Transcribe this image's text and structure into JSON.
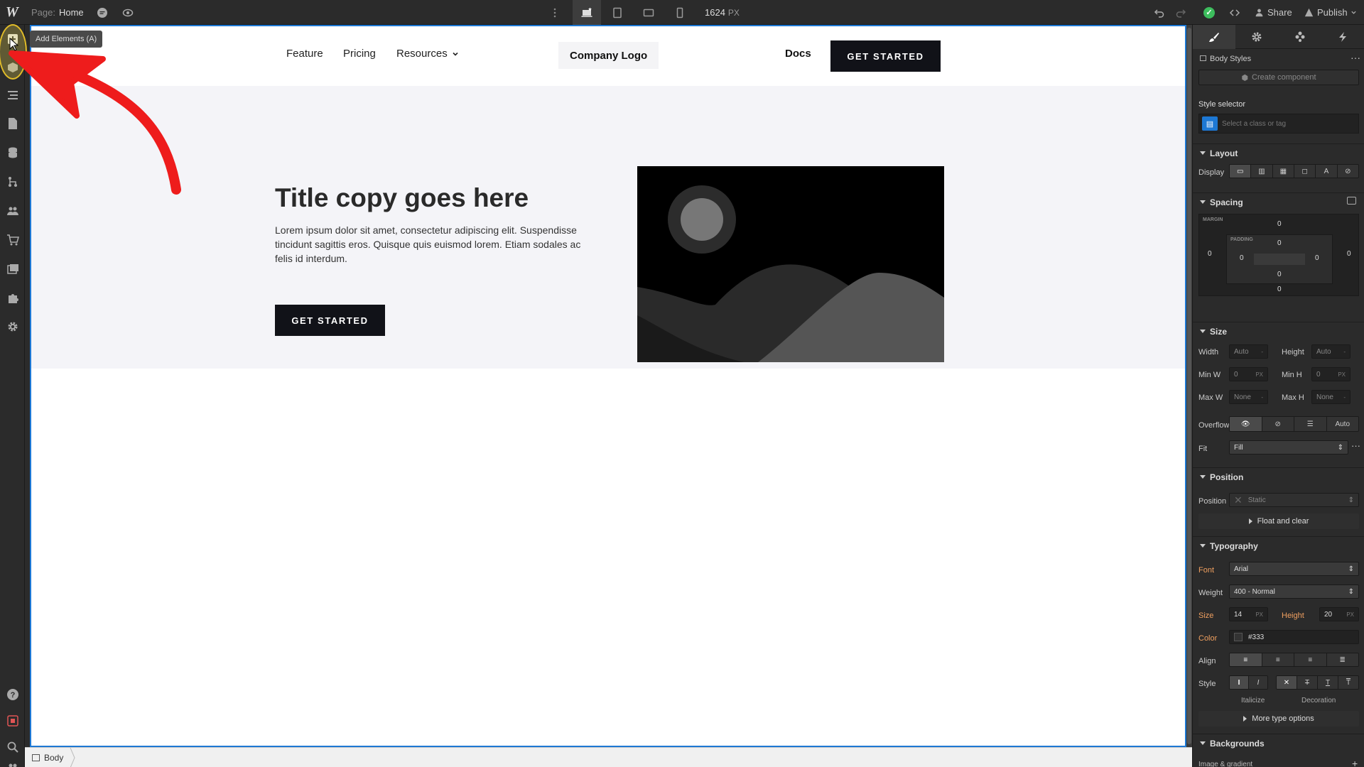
{
  "topbar": {
    "logo": "W",
    "page_prefix": "Page:",
    "page_name": "Home",
    "canvas_width": "1624",
    "canvas_unit": "PX",
    "share_label": "Share",
    "publish_label": "Publish"
  },
  "leftbar": {
    "tooltip": "Add Elements (A)",
    "icons": [
      "add-elements-icon",
      "components-icon",
      "navigator-icon",
      "pages-icon",
      "cms-icon",
      "logic-icon",
      "users-icon",
      "ecommerce-icon",
      "assets-icon",
      "apps-icon",
      "settings-icon",
      "help-icon",
      "video-icon",
      "search-icon",
      "collaborators-icon"
    ]
  },
  "site": {
    "nav": {
      "links": [
        "Feature",
        "Pricing",
        "Resources"
      ],
      "logo": "Company Logo",
      "docs": "Docs",
      "cta": "GET STARTED"
    },
    "hero": {
      "title": "Title copy goes here",
      "body": "Lorem ipsum dolor sit amet, consectetur adipiscing elit. Suspendisse tincidunt sagittis eros. Quisque quis euismod lorem. Etiam sodales ac felis id interdum.",
      "cta": "GET STARTED"
    }
  },
  "breadcrumb": {
    "item": "Body"
  },
  "panel": {
    "selection": "Body Styles",
    "create_component": "Create component",
    "style_selector_label": "Style selector",
    "style_selector_placeholder": "Select a class or tag",
    "layout": {
      "heading": "Layout",
      "display_label": "Display"
    },
    "spacing": {
      "heading": "Spacing",
      "margin_label": "MARGIN",
      "padding_label": "PADDING",
      "margin": {
        "top": "0",
        "right": "0",
        "bottom": "0",
        "left": "0"
      },
      "padding": {
        "top": "0",
        "right": "0",
        "bottom": "0",
        "left": "0"
      }
    },
    "size": {
      "heading": "Size",
      "width_label": "Width",
      "width_value": "Auto",
      "height_label": "Height",
      "height_value": "Auto",
      "minw_label": "Min W",
      "minw_value": "0",
      "minw_unit": "PX",
      "minh_label": "Min H",
      "minh_value": "0",
      "minh_unit": "PX",
      "maxw_label": "Max W",
      "maxw_value": "None",
      "maxh_label": "Max H",
      "maxh_value": "None",
      "overflow_label": "Overflow",
      "overflow_auto": "Auto",
      "fit_label": "Fit",
      "fit_value": "Fill"
    },
    "position": {
      "heading": "Position",
      "position_label": "Position",
      "position_value": "Static",
      "float_clear": "Float and clear"
    },
    "typography": {
      "heading": "Typography",
      "font_label": "Font",
      "font_value": "Arial",
      "weight_label": "Weight",
      "weight_value": "400 - Normal",
      "size_label": "Size",
      "size_value": "14",
      "size_unit": "PX",
      "height_label": "Height",
      "height_value": "20",
      "height_unit": "PX",
      "color_label": "Color",
      "color_value": "#333",
      "align_label": "Align",
      "style_label": "Style",
      "italicize_label": "Italicize",
      "decoration_label": "Decoration",
      "more_options": "More type options"
    },
    "backgrounds": {
      "heading": "Backgrounds",
      "sub": "Image & gradient"
    }
  },
  "colors": {
    "accent_blue": "#1d78d4",
    "cta_dark": "#111218",
    "annotation_red": "#ee1c1c",
    "status_green": "#3dbd5d",
    "label_orange": "#f0a060"
  }
}
